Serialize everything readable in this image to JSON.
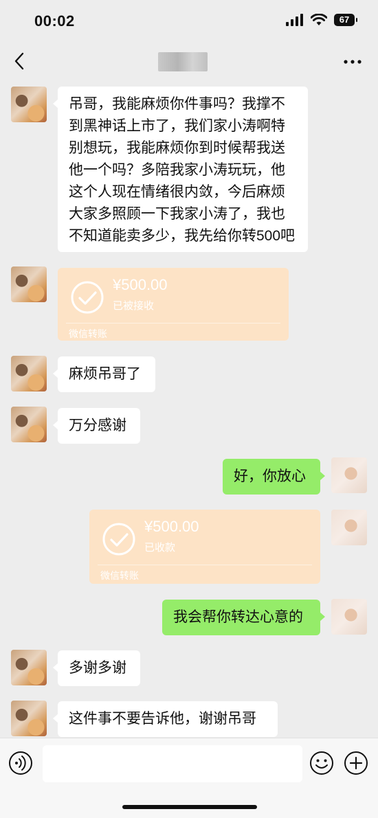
{
  "status_bar": {
    "time": "00:02",
    "battery": "67"
  },
  "nav": {
    "back_icon": "chevron-left-icon",
    "more_icon": "more-dots-icon"
  },
  "messages": [
    {
      "side": "left",
      "type": "text",
      "text": "吊哥，我能麻烦你件事吗？我撑不到黑神话上市了，我们家小涛啊特别想玩，我能麻烦你到时候帮我送他一个吗？多陪我家小涛玩玩，他这个人现在情绪很内敛，今后麻烦大家多照顾一下我家小涛了，我也不知道能卖多少，我先给你转500吧"
    },
    {
      "side": "left",
      "type": "transfer",
      "amount": "¥500.00",
      "status": "已被接收",
      "footer": "微信转账"
    },
    {
      "side": "left",
      "type": "text",
      "text": "麻烦吊哥了"
    },
    {
      "side": "left",
      "type": "text",
      "text": "万分感谢"
    },
    {
      "side": "right",
      "type": "text",
      "text": "好，你放心"
    },
    {
      "side": "right",
      "type": "transfer",
      "amount": "¥500.00",
      "status": "已收款",
      "footer": "微信转账"
    },
    {
      "side": "right",
      "type": "text",
      "text": "我会帮你转达心意的"
    },
    {
      "side": "left",
      "type": "text",
      "text": "多谢多谢"
    },
    {
      "side": "left",
      "type": "text",
      "text": "这件事不要告诉他，谢谢吊哥"
    }
  ],
  "input_bar": {
    "voice_icon": "voice-icon",
    "emoji_icon": "emoji-icon",
    "plus_icon": "plus-icon",
    "placeholder": ""
  },
  "colors": {
    "bg": "#ededed",
    "bubble_right": "#95ec69",
    "bubble_left": "#ffffff",
    "transfer": "#fde3c6"
  }
}
